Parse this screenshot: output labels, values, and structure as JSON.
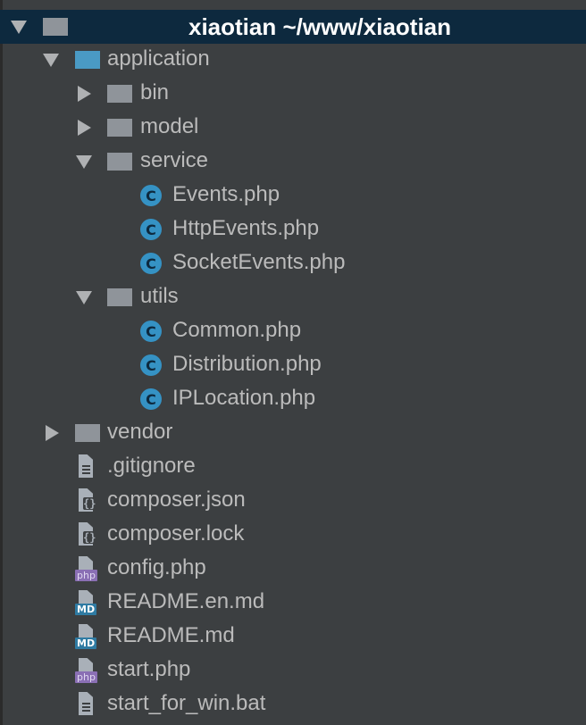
{
  "root": {
    "name": "xiaotian",
    "path": "~/www/xiaotian",
    "title": "xiaotian ~/www/xiaotian"
  },
  "folders": {
    "application": "application",
    "bin": "bin",
    "model": "model",
    "service": "service",
    "utils": "utils",
    "vendor": "vendor"
  },
  "service_files": [
    "Events.php",
    "HttpEvents.php",
    "SocketEvents.php"
  ],
  "utils_files": [
    "Common.php",
    "Distribution.php",
    "IPLocation.php"
  ],
  "root_files": {
    "gitignore": ".gitignore",
    "composer_json": "composer.json",
    "composer_lock": "composer.lock",
    "config_php": "config.php",
    "readme_en": "README.en.md",
    "readme": "README.md",
    "start_php": "start.php",
    "start_bat": "start_for_win.bat"
  },
  "icons": {
    "class_letter": "C",
    "php_badge": "php",
    "md_badge": "MD",
    "json_glyph": "{}"
  },
  "colors": {
    "background": "#3c3f41",
    "selection": "#0d293e",
    "text": "#bbbbbb",
    "folder_gray": "#8f949a",
    "folder_blue": "#4a9ac4",
    "class_icon": "#3592c4"
  }
}
